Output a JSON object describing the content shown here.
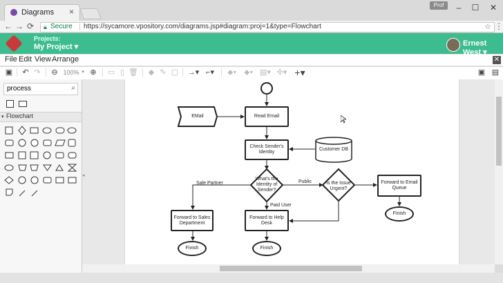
{
  "browser": {
    "tab_title": "Diagrams",
    "tab_close": "×",
    "profile_badge": "Prof",
    "window_min": "–",
    "window_max": "☐",
    "window_close": "✕",
    "secure_label": "Secure",
    "url": "https://sycamore.vpository.com/diagrams.jsp#diagram:proj=1&type=Flowchart"
  },
  "app": {
    "projects_label": "Projects:",
    "project_name": "My Project ▾",
    "user_name": "Ernest West ▾",
    "brand_color": "#3dbc8f"
  },
  "menubar": {
    "items": [
      "File",
      "Edit",
      "View",
      "Arrange"
    ],
    "close": "✕"
  },
  "toolbar": {
    "zoom": "100%"
  },
  "sidebar": {
    "search_value": "process",
    "section_title": "Flowchart"
  },
  "diagram": {
    "nodes": {
      "email": "EMail",
      "read_email": "Read Email",
      "check_identity": "Check Sender's Identity",
      "customer_db": "Customer DB",
      "whats_identity": "What's the Identity of Sender?",
      "is_urgent": "Is the Issue Urgent?",
      "forward_email_queue": "Forward to Email Queue",
      "forward_sales": "Forward to Sales Department",
      "forward_help": "Forward to Help Desk",
      "finish_1": "Finish",
      "finish_2": "Finish",
      "finish_3": "Finish"
    },
    "edges": {
      "sale_partner": "Sale Partner",
      "public": "Public",
      "paid_user": "Paid User"
    }
  }
}
